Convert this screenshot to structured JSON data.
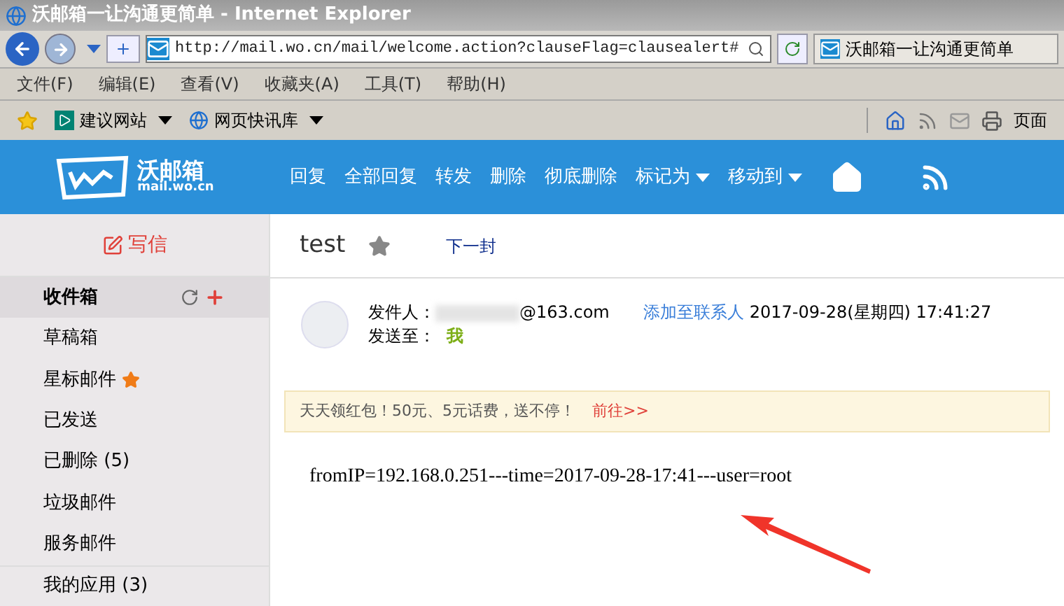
{
  "window": {
    "title": "沃邮箱一让沟通更简单 - Internet Explorer"
  },
  "address_bar": {
    "url": "http://mail.wo.cn/mail/welcome.action?clauseFlag=clausealert#"
  },
  "tab": {
    "title": "沃邮箱一让沟通更简单"
  },
  "menu": [
    "文件(F)",
    "编辑(E)",
    "查看(V)",
    "收藏夹(A)",
    "工具(T)",
    "帮助(H)"
  ],
  "favorites": [
    {
      "label": "建议网站",
      "kind": "bing"
    },
    {
      "label": "网页快讯库",
      "kind": "ie"
    }
  ],
  "command_bar": {
    "page_label": "页面"
  },
  "app": {
    "logo_text": "沃邮箱",
    "logo_domain": "mail.wo.cn",
    "toolbar": [
      {
        "label": "回复",
        "dropdown": false
      },
      {
        "label": "全部回复",
        "dropdown": false
      },
      {
        "label": "转发",
        "dropdown": false
      },
      {
        "label": "删除",
        "dropdown": false
      },
      {
        "label": "彻底删除",
        "dropdown": false
      },
      {
        "label": "标记为",
        "dropdown": true
      },
      {
        "label": "移动到",
        "dropdown": true
      }
    ],
    "compose": "写信",
    "folders": [
      {
        "label": "收件箱",
        "selected": true,
        "starred": false
      },
      {
        "label": "草稿箱",
        "selected": false,
        "starred": false
      },
      {
        "label": "星标邮件",
        "selected": false,
        "starred": true
      },
      {
        "label": "已发送",
        "selected": false,
        "starred": false
      },
      {
        "label": "已删除 (5)",
        "selected": false,
        "starred": false
      },
      {
        "label": "垃圾邮件",
        "selected": false,
        "starred": false
      },
      {
        "label": "服务邮件",
        "selected": false,
        "starred": false
      },
      {
        "label": "我的应用 (3)",
        "selected": false,
        "starred": false
      }
    ],
    "message": {
      "subject": "test",
      "starred": false,
      "next": "下一封",
      "from_label": "发件人：",
      "from": "@163.com",
      "add_contact": "添加至联系人",
      "date": "2017-09-28(星期四) 17:41:27",
      "to_label": "发送至：",
      "to": "我",
      "banner": "天天领红包！50元、5元话费，送不停！",
      "banner_link": "前往>>",
      "body": "fromIP=192.168.0.251---time=2017-09-28-17:41---user=root"
    }
  }
}
